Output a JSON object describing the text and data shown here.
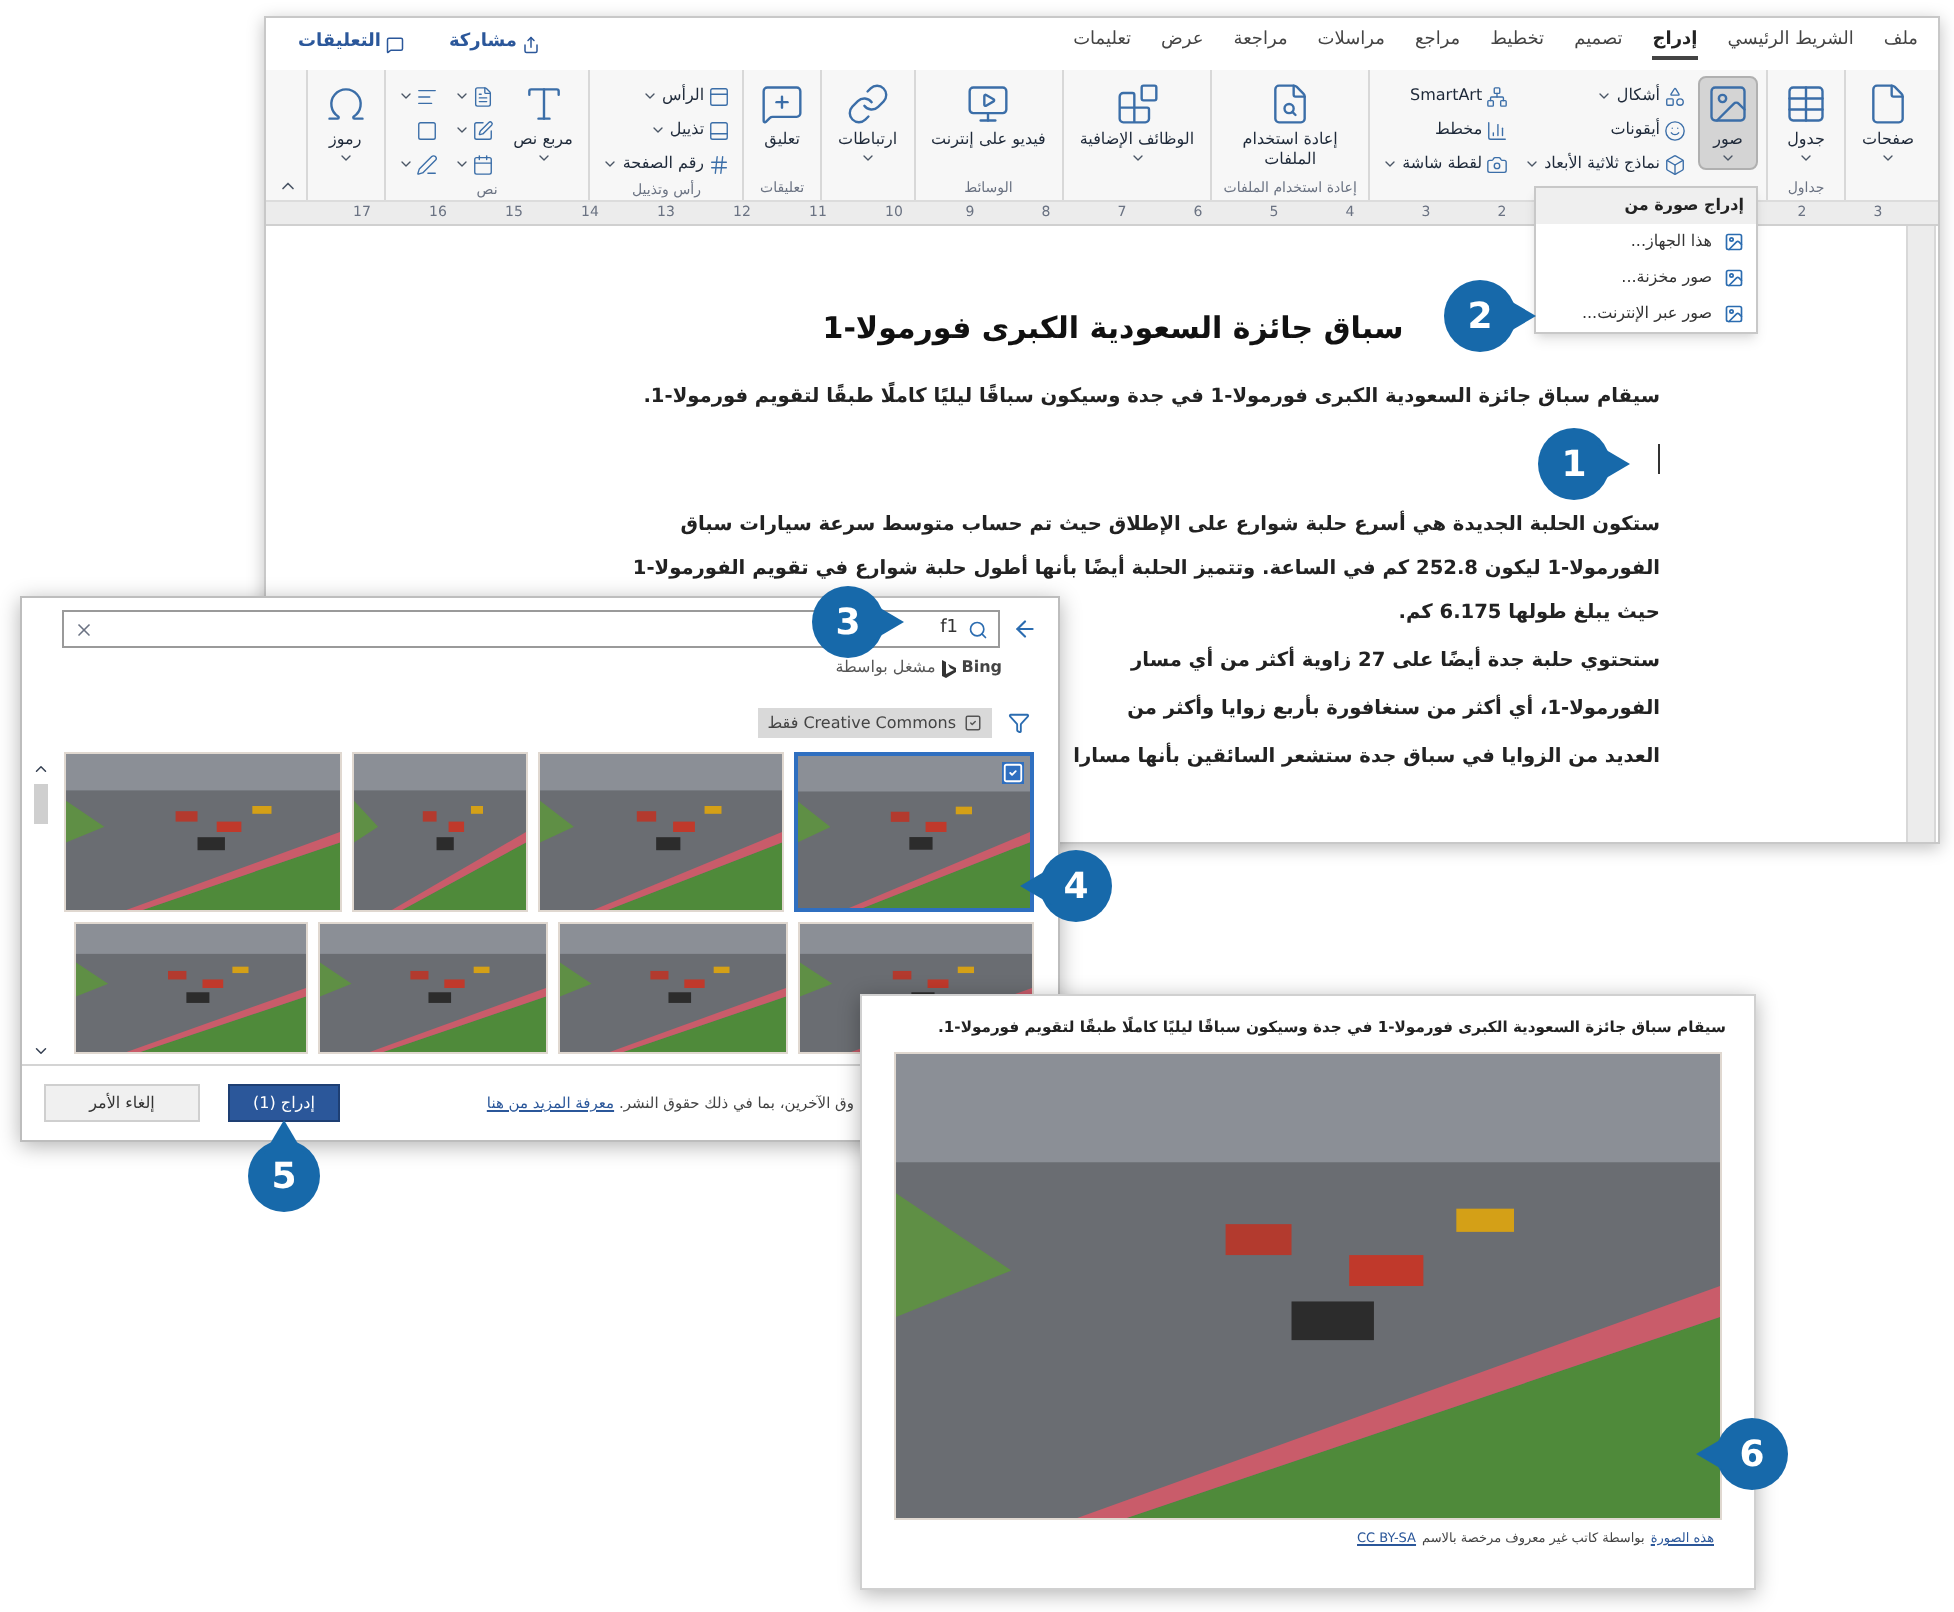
{
  "word_window": {
    "menu_tabs": [
      {
        "label": "ملف",
        "selected": false
      },
      {
        "label": "الشريط الرئيسي",
        "selected": false
      },
      {
        "label": "إدراج",
        "selected": true
      },
      {
        "label": "تصميم",
        "selected": false
      },
      {
        "label": "تخطيط",
        "selected": false
      },
      {
        "label": "مراجع",
        "selected": false
      },
      {
        "label": "مراسلات",
        "selected": false
      },
      {
        "label": "مراجعة",
        "selected": false
      },
      {
        "label": "عرض",
        "selected": false
      },
      {
        "label": "تعليمات",
        "selected": false
      }
    ],
    "share_button": "مشاركة",
    "comments_button": "التعليقات",
    "ribbon_groups": [
      {
        "buttons": [
          {
            "label": "صفحات",
            "kind": "large",
            "dropdown": true,
            "pressed": false
          }
        ]
      },
      {
        "label": "جداول",
        "buttons": [
          {
            "label": "جدول",
            "kind": "large",
            "dropdown": true,
            "pressed": false
          }
        ]
      },
      {
        "buttons": [
          {
            "label": "صور",
            "kind": "large",
            "dropdown": true,
            "pressed": true
          },
          {
            "label": "أشكال",
            "kind": "small",
            "dropdown": true,
            "pressed": false
          },
          {
            "label": "أيقونات",
            "kind": "small",
            "dropdown": false,
            "pressed": false
          },
          {
            "label": "نماذج ثلاثية الأبعاد",
            "kind": "small",
            "dropdown": true,
            "pressed": false
          },
          {
            "label": "SmartArt",
            "kind": "small",
            "dropdown": false,
            "pressed": false
          },
          {
            "label": "مخطط",
            "kind": "small",
            "dropdown": false,
            "pressed": false
          },
          {
            "label": "لقطة شاشة",
            "kind": "small",
            "dropdown": true,
            "pressed": false
          }
        ]
      },
      {
        "label": "إعادة استخدام الملفات",
        "buttons": [
          {
            "label": "إعادة استخدام الملفات",
            "kind": "large",
            "dropdown": false,
            "pressed": false
          }
        ]
      },
      {
        "buttons": [
          {
            "label": "الوظائف الإضافية",
            "kind": "large",
            "dropdown": true,
            "pressed": false
          }
        ]
      },
      {
        "label": "الوسائط",
        "buttons": [
          {
            "label": "فيديو على إنترنت",
            "kind": "large",
            "dropdown": false,
            "pressed": false
          }
        ]
      },
      {
        "buttons": [
          {
            "label": "ارتباطات",
            "kind": "large",
            "dropdown": true,
            "pressed": false
          }
        ]
      },
      {
        "label": "تعليقات",
        "buttons": [
          {
            "label": "تعليق",
            "kind": "large",
            "dropdown": false,
            "pressed": false
          }
        ]
      },
      {
        "label": "رأس وتذييل",
        "buttons": [
          {
            "label": "الرأس",
            "kind": "small",
            "dropdown": true,
            "pressed": false
          },
          {
            "label": "تذييل",
            "kind": "small",
            "dropdown": true,
            "pressed": false
          },
          {
            "label": "رقم الصفحة",
            "kind": "small",
            "dropdown": true,
            "pressed": false
          }
        ]
      },
      {
        "label": "نص",
        "buttons": [
          {
            "label": "مربع نص",
            "kind": "large",
            "dropdown": true,
            "pressed": false
          },
          {
            "kind": "icon",
            "dropdown": true,
            "pressed": false
          },
          {
            "kind": "icon",
            "dropdown": true,
            "pressed": false
          },
          {
            "kind": "icon",
            "dropdown": true,
            "pressed": false
          },
          {
            "kind": "icon",
            "dropdown": true,
            "pressed": false
          },
          {
            "kind": "icon",
            "dropdown": false,
            "pressed": false
          },
          {
            "kind": "icon",
            "dropdown": true,
            "pressed": false
          }
        ]
      },
      {
        "buttons": [
          {
            "label": "رموز",
            "kind": "large",
            "dropdown": true,
            "pressed": false
          }
        ]
      }
    ],
    "insert_picture_menu": {
      "title": "إدراج صورة من",
      "items": [
        "هذا الجهاز...",
        "صور مخزنة...",
        "صور عبر الإنترنت..."
      ]
    },
    "ruler": [
      "3",
      "2",
      "2",
      "3",
      "4",
      "5",
      "6",
      "7",
      "8",
      "9",
      "10",
      "11",
      "12",
      "13",
      "14",
      "15",
      "16",
      "17"
    ],
    "document": {
      "title": "سباق جائزة السعودية الكبرى فورمولا-1",
      "paragraphs": [
        "سيقام سباق جائزة السعودية الكبرى فورمولا-1 في جدة وسيكون سباقًا ليليًا كاملًا طبقًا لتقويم فورمولا-1."
      ],
      "paragraph_lines": [
        "ستكون الحلبة الجديدة هي أسرع حلبة شوارع على الإطلاق حيث تم حساب متوسط سرعة سيارات سباق",
        "الفورمولا-1 ليكون 252.8 كم في الساعة. وتتميز الحلبة أيضًا بأنها أطول حلبة شوارع في تقويم الفورمولا-1",
        "حيث يبلغ طولها 6.175 كم."
      ],
      "partial_lines": [
        "ستحتوي حلبة جدة أيضًا على 27 زاوية أكثر من أي مسار",
        "الفورمولا-1، أي أكثر من سنغافورة بأربع زوايا وأكثر من",
        "العديد من الزوايا في سباق جدة ستشعر السائقين بأنها مسارا"
      ]
    }
  },
  "dialog": {
    "search": {
      "value": "f1"
    },
    "powered_by": "مشغل بواسطة",
    "brand": "Bing",
    "filter": {
      "label": "Creative Commons فقط",
      "checked": true
    },
    "images": [
      {
        "selected": true
      },
      {
        "selected": false
      },
      {
        "selected": false
      },
      {
        "selected": false
      },
      {
        "selected": false
      },
      {
        "selected": false
      },
      {
        "selected": false
      },
      {
        "selected": false
      }
    ],
    "footer_text": "وق الآخرين، بما في ذلك حقوق النشر.",
    "footer_link": "معرفة المزيد من هنا",
    "buttons": [
      {
        "label": "إدراج (1)",
        "kind": "primary"
      },
      {
        "label": "إلغاء الأمر",
        "kind": "secondary"
      }
    ]
  },
  "result_card": {
    "text": "سيقام سباق جائزة السعودية الكبرى فورمولا-1 في جدة وسيكون سباقًا ليليًا كاملًا طبقًا لتقويم فورمولا-1.",
    "caption": {
      "link": "هذه الصورة",
      "text": "بواسطة كاتب غير معروف مرخصة بالاسم",
      "license": "CC BY-SA"
    }
  },
  "callouts": [
    {
      "number": "1"
    },
    {
      "number": "2"
    },
    {
      "number": "3"
    },
    {
      "number": "4"
    },
    {
      "number": "5"
    },
    {
      "number": "6"
    }
  ]
}
